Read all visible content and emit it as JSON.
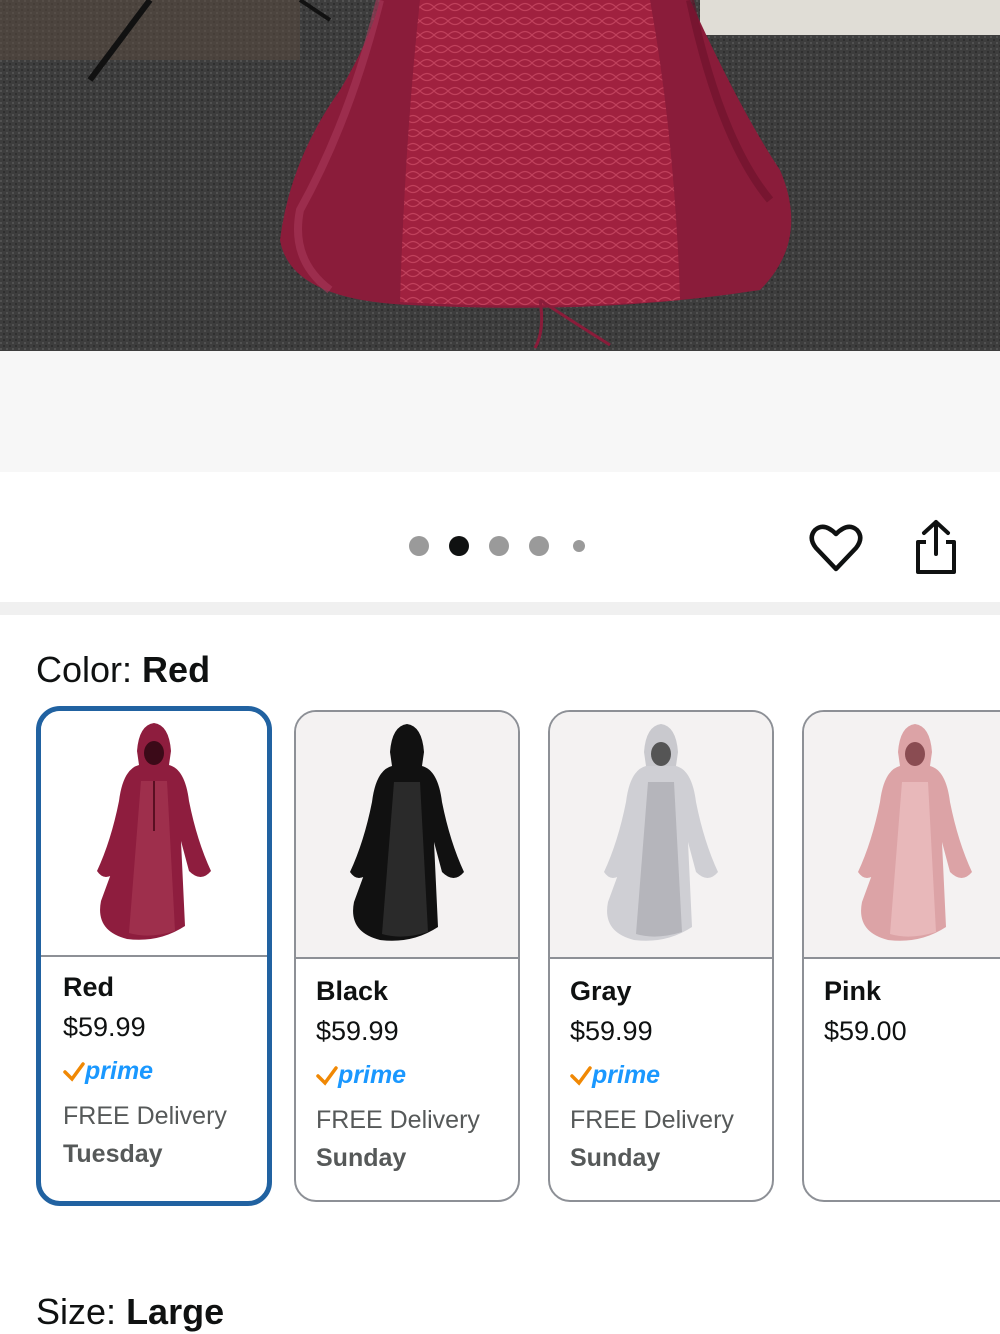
{
  "gallery": {
    "dots": [
      {
        "active": false
      },
      {
        "active": true
      },
      {
        "active": false
      },
      {
        "active": false
      },
      {
        "active": false,
        "small": true
      }
    ],
    "favorite_icon": "heart-outline-icon",
    "share_icon": "share-icon"
  },
  "color": {
    "label": "Color:",
    "selected": "Red",
    "options": [
      {
        "name": "Red",
        "price": "$59.99",
        "prime": "prime",
        "delivery": "FREE Delivery",
        "day": "Tuesday",
        "dress_color": "#8e1d3e",
        "selected": true
      },
      {
        "name": "Black",
        "price": "$59.99",
        "prime": "prime",
        "delivery": "FREE Delivery",
        "day": "Sunday",
        "dress_color": "#111111",
        "selected": false
      },
      {
        "name": "Gray",
        "price": "$59.99",
        "prime": "prime",
        "delivery": "FREE Delivery",
        "day": "Sunday",
        "dress_color": "#cfcfd4",
        "selected": false
      },
      {
        "name": "Pink",
        "price": "$59.00",
        "dress_color": "#dca3a6",
        "selected": false
      }
    ]
  },
  "size": {
    "label": "Size:",
    "selected": "Large"
  },
  "colors": {
    "accent_border": "#2162a1",
    "prime_blue": "#1a98ff",
    "prime_check": "#f08804"
  }
}
